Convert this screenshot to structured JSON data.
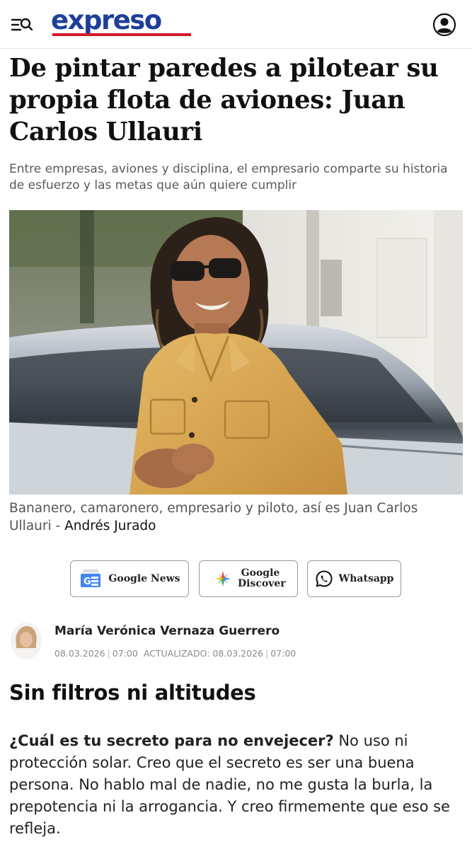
{
  "header": {
    "logo_text": "expreso",
    "menu_icon": "menu-search-icon",
    "user_icon": "user-account-icon",
    "brand_blue": "#1d3f9a",
    "brand_red": "#d21a2a"
  },
  "article": {
    "headline": "De pintar paredes a pilotear su propia flota de aviones: Juan Carlos Ullauri",
    "subtitle": "Entre empresas, aviones y disciplina, el empresario comparte su historia de esfuerzo y las metas que aún quiere cumplir",
    "photo_caption": "Bananero, camaronero, empresario y piloto, así es Juan Carlos Ullauri",
    "caption_separator": " - ",
    "photo_credit": "Andrés Jurado"
  },
  "share": {
    "google_news_label": "Google News",
    "google_discover_label": "Google Discover",
    "whatsapp_label": "Whatsapp"
  },
  "author": {
    "name": "María Verónica Vernaza Guerrero",
    "published_date": "08.03.2026",
    "published_time": "07:00",
    "updated_label": "ACTUALIZADO:",
    "updated_date": "08.03.2026",
    "updated_time": "07:00"
  },
  "section": {
    "title": "Sin filtros ni altitudes"
  },
  "body": {
    "question": "¿Cuál es tu secreto para no envejecer?",
    "answer": " No uso ni protección solar. Creo que el secreto es ser una buena persona. No hablo mal de nadie, no me gusta la burla, la prepotencia ni la arrogancia. Y creo firmemente que eso se refleja."
  }
}
